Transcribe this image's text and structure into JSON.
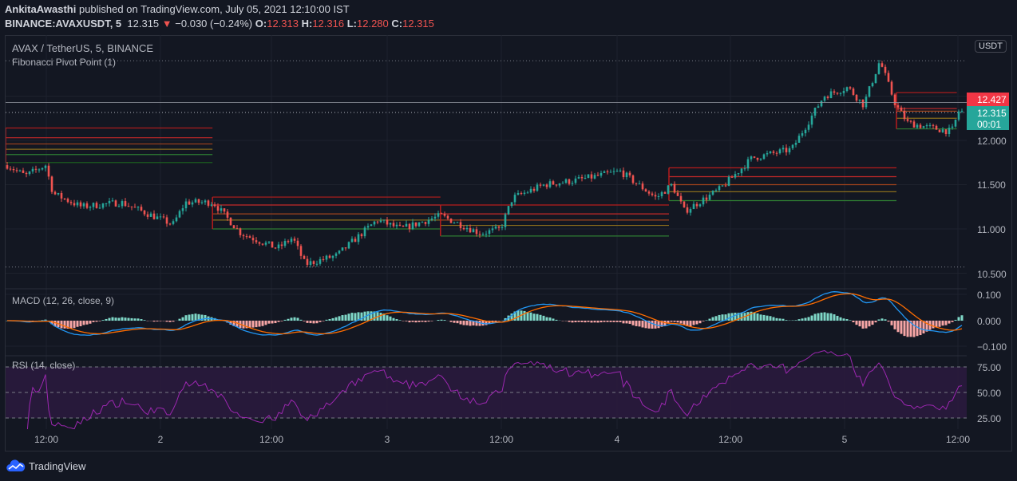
{
  "header": {
    "author": "AnkitaAwasthi",
    "published_text": "published on TradingView.com, July 05, 2021 12:10:00 IST",
    "symbol": "BINANCE:AVAXUSDT, 5",
    "last": "12.315",
    "change": "−0.030 (−0.24%)",
    "o_label": "O:",
    "o": "12.313",
    "h_label": "H:",
    "h": "12.316",
    "l_label": "L:",
    "l": "12.280",
    "c_label": "C:",
    "c": "12.315"
  },
  "legend": {
    "main": "AVAX / TetherUS, 5, BINANCE",
    "indicator": "Fibonacci Pivot Point (1)",
    "macd": "MACD (12, 26, close, 9)",
    "rsi": "RSI (14, close)"
  },
  "price_axis": {
    "currency": "USDT",
    "labels": [
      "12.000",
      "11.500",
      "11.000",
      "10.500"
    ],
    "tag_high": "12.427",
    "tag_last": "12.315",
    "tag_timer": "00:01",
    "macd_labels": [
      "0.100",
      "0.000",
      "−0.100"
    ],
    "rsi_labels": [
      "75.00",
      "50.00",
      "25.00"
    ]
  },
  "time_axis": [
    "12:00",
    "2",
    "12:00",
    "3",
    "12:00",
    "4",
    "12:00",
    "5",
    "12:00"
  ],
  "brand": "TradingView",
  "colors": {
    "up": "#26a69a",
    "down": "#ef5350",
    "macd": "#2196f3",
    "signal": "#ff6d00",
    "rsi": "#9c27b0"
  },
  "chart_data": {
    "type": "candlestick",
    "ylim": [
      10.5,
      12.9
    ],
    "x_unit": "hours",
    "price_path": [
      [
        0,
        11.72
      ],
      [
        1.9,
        11.6
      ],
      [
        4,
        11.72
      ],
      [
        4.8,
        11.4
      ],
      [
        7.75,
        11.25
      ],
      [
        11.9,
        11.3
      ],
      [
        17.3,
        11.05
      ],
      [
        18.6,
        11.3
      ],
      [
        21.5,
        11.3
      ],
      [
        24.4,
        10.95
      ],
      [
        28.2,
        10.78
      ],
      [
        29.8,
        10.9
      ],
      [
        31.1,
        10.6
      ],
      [
        34.4,
        10.7
      ],
      [
        38.6,
        11.1
      ],
      [
        41.1,
        11.0
      ],
      [
        45.25,
        11.15
      ],
      [
        49.4,
        10.95
      ],
      [
        51.5,
        11.0
      ],
      [
        52.75,
        11.35
      ],
      [
        56.1,
        11.5
      ],
      [
        59.4,
        11.55
      ],
      [
        64,
        11.65
      ],
      [
        67.75,
        11.35
      ],
      [
        69.4,
        11.5
      ],
      [
        70.7,
        11.2
      ],
      [
        74.4,
        11.45
      ],
      [
        77.75,
        11.8
      ],
      [
        81.9,
        11.9
      ],
      [
        85.25,
        12.5
      ],
      [
        87.75,
        12.6
      ],
      [
        89.4,
        12.4
      ],
      [
        91.1,
        12.9
      ],
      [
        92.75,
        12.4
      ],
      [
        94,
        12.2
      ],
      [
        96,
        12.15
      ],
      [
        98.6,
        12.1
      ],
      [
        99.4,
        12.35
      ],
      [
        99.8,
        12.315
      ]
    ],
    "pivots": [
      {
        "start": 0,
        "end": 21.6,
        "levels": [
          12.14,
          12.03,
          11.96,
          11.9,
          11.84,
          11.75
        ]
      },
      {
        "start": 21.6,
        "end": 45.4,
        "levels": [
          11.36,
          11.27,
          11.17,
          11.1,
          11.0
        ]
      },
      {
        "start": 45.4,
        "end": 69.25,
        "levels": [
          11.27,
          11.17,
          11.1,
          11.04,
          10.92
        ]
      },
      {
        "start": 69.25,
        "end": 93,
        "levels": [
          11.69,
          11.59,
          11.5,
          11.42,
          11.32
        ]
      },
      {
        "start": 93,
        "end": 99.3,
        "levels": [
          12.54,
          12.36,
          12.33,
          12.25,
          12.13
        ]
      }
    ],
    "high_line": 12.427,
    "last_price": 12.315
  }
}
